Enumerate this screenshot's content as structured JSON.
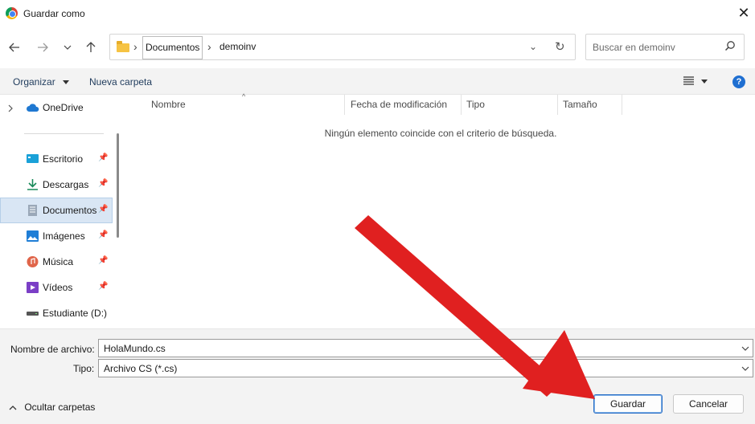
{
  "window": {
    "title": "Guardar como",
    "close_symbol": "✕"
  },
  "nav": {
    "back_icon": "arrow-left-icon",
    "forward_icon": "arrow-right-icon",
    "recent_icon": "chevron-down-icon",
    "up_icon": "arrow-up-icon",
    "breadcrumbs": [
      "Documentos",
      "demoinv"
    ],
    "search_placeholder": "Buscar en demoinv"
  },
  "toolbar": {
    "organize_label": "Organizar",
    "new_folder_label": "Nueva carpeta",
    "help_symbol": "?"
  },
  "sidebar": {
    "top_items": [
      {
        "label": "OneDrive",
        "icon": "cloud-icon",
        "color": "#1f78d1"
      }
    ],
    "items": [
      {
        "label": "Escritorio",
        "icon": "desktop-icon",
        "color": "#1aa1d8",
        "pinned": true
      },
      {
        "label": "Descargas",
        "icon": "download-icon",
        "color": "#1a8a5a",
        "pinned": true
      },
      {
        "label": "Documentos",
        "icon": "document-icon",
        "color": "#7f8fa3",
        "pinned": true,
        "selected": true
      },
      {
        "label": "Imágenes",
        "icon": "image-icon",
        "color": "#1f7ed6",
        "pinned": true
      },
      {
        "label": "Música",
        "icon": "music-icon",
        "color": "#e0654a",
        "pinned": true
      },
      {
        "label": "Vídeos",
        "icon": "video-icon",
        "color": "#7b3fc6",
        "pinned": true
      },
      {
        "label": "Estudiante (D:)",
        "icon": "drive-icon",
        "color": "#555555",
        "pinned": false
      }
    ]
  },
  "content": {
    "columns": [
      "Nombre",
      "Fecha de modificación",
      "Tipo",
      "Tamaño"
    ],
    "empty_message": "Ningún elemento coincide con el criterio de búsqueda."
  },
  "form": {
    "filename_label": "Nombre de archivo:",
    "filename_value": "HolaMundo.cs",
    "type_label": "Tipo:",
    "type_value": "Archivo CS (*.cs)"
  },
  "footer": {
    "hide_folders_label": "Ocultar carpetas",
    "save_label": "Guardar",
    "cancel_label": "Cancelar"
  },
  "annotation": {
    "arrow_color": "#e02020"
  }
}
